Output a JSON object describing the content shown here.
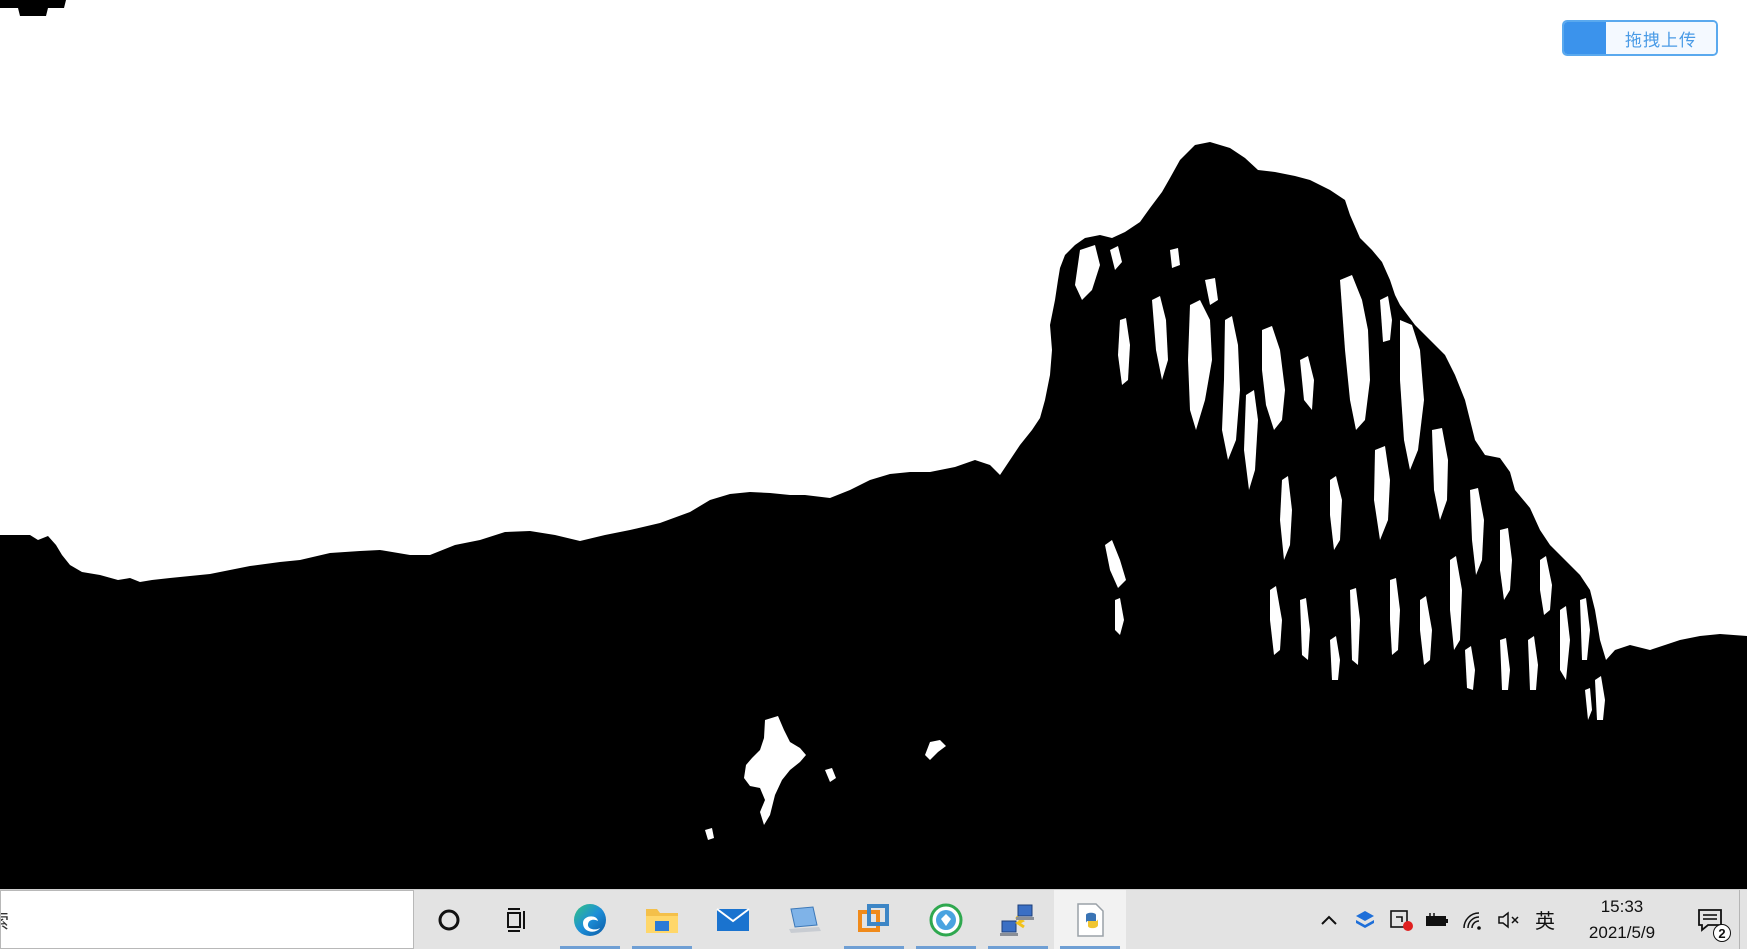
{
  "viewer": {
    "content": "binary black-and-white image of a rocky outcrop",
    "colors": {
      "foreground": "#000000",
      "background": "#ffffff"
    }
  },
  "drag_upload": {
    "label": "拖拽上传",
    "icon": "baidu-cloud-icon",
    "accent": "#3b93ec"
  },
  "taskbar": {
    "search_text": "索",
    "apps": [
      {
        "name": "cortana",
        "icon": "cortana-circle-icon",
        "running": false
      },
      {
        "name": "task-view",
        "icon": "task-view-icon",
        "running": false
      },
      {
        "name": "edge",
        "icon": "edge-icon",
        "running": true
      },
      {
        "name": "file-explorer",
        "icon": "folder-icon",
        "running": true
      },
      {
        "name": "mail",
        "icon": "mail-icon",
        "running": false
      },
      {
        "name": "this-pc",
        "icon": "laptop-icon",
        "running": false
      },
      {
        "name": "vmware",
        "icon": "vmware-icon",
        "running": true
      },
      {
        "name": "globe-app",
        "icon": "green-globe-icon",
        "running": true
      },
      {
        "name": "network-app",
        "icon": "network-computers-icon",
        "running": true
      },
      {
        "name": "python",
        "icon": "python-file-icon",
        "running": true,
        "active": true
      }
    ],
    "tray": {
      "icons": [
        "chevron-up-icon",
        "dropbox-icon",
        "security-icon",
        "battery-icon",
        "wifi-icon",
        "volume-muted-icon"
      ],
      "ime": "英",
      "time": "15:33",
      "date": "2021/5/9",
      "notifications": "2"
    }
  }
}
